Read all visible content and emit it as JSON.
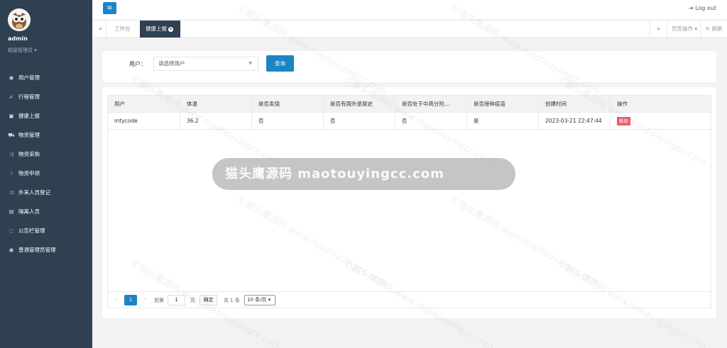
{
  "sidebar": {
    "user_name": "admin",
    "user_role": "超级管理员",
    "items": [
      {
        "label": "用户管理",
        "icon": "user-circle-icon"
      },
      {
        "label": "行程管理",
        "icon": "location-arrow-icon"
      },
      {
        "label": "健康上报",
        "icon": "calendar-icon"
      },
      {
        "label": "物资管理",
        "icon": "truck-icon"
      },
      {
        "label": "物资采购",
        "icon": "shuffle-icon"
      },
      {
        "label": "物资申领",
        "icon": "hand-icon"
      },
      {
        "label": "外来人员登记",
        "icon": "shuffle-icon"
      },
      {
        "label": "隔离人员",
        "icon": "id-card-icon"
      },
      {
        "label": "公告栏管理",
        "icon": "chat-icon"
      },
      {
        "label": "普通管理员管理",
        "icon": "user-circle-icon"
      }
    ]
  },
  "header": {
    "logout_label": "Log out"
  },
  "tabs": {
    "items": [
      {
        "label": "工作台",
        "active": false
      },
      {
        "label": "健康上报",
        "active": true
      }
    ],
    "ops_label": "页签操作",
    "refresh_label": "刷新"
  },
  "search": {
    "user_label": "用户：",
    "user_placeholder": "请选择用户",
    "query_button": "查询"
  },
  "table": {
    "columns": [
      "用户",
      "体温",
      "是否发烧",
      "是否有国外旅居史",
      "是否处于中高分险...",
      "是否接种疫苗",
      "创建时间",
      "操作"
    ],
    "rows": [
      {
        "user": "mtycode",
        "temp": "36.2",
        "fever": "否",
        "abroad": "否",
        "risk": "否",
        "vaccine": "是",
        "created": "2023-03-21 22:47:44",
        "action": "删除"
      }
    ]
  },
  "pager": {
    "current_page": "1",
    "goto_label": "到第",
    "goto_value": "1",
    "page_label": "页",
    "confirm_label": "确定",
    "total_label": "共 1 条",
    "page_size": "10 条/页"
  },
  "watermark": {
    "banner_text": "猫头鹰源码 maotouyingcc.com",
    "tile_text": "©猫头鹰源码 www.maotouyingcc.com"
  },
  "colors": {
    "sidebar_bg": "#2f4050",
    "primary": "#1c84c6",
    "danger": "#ed5565"
  }
}
